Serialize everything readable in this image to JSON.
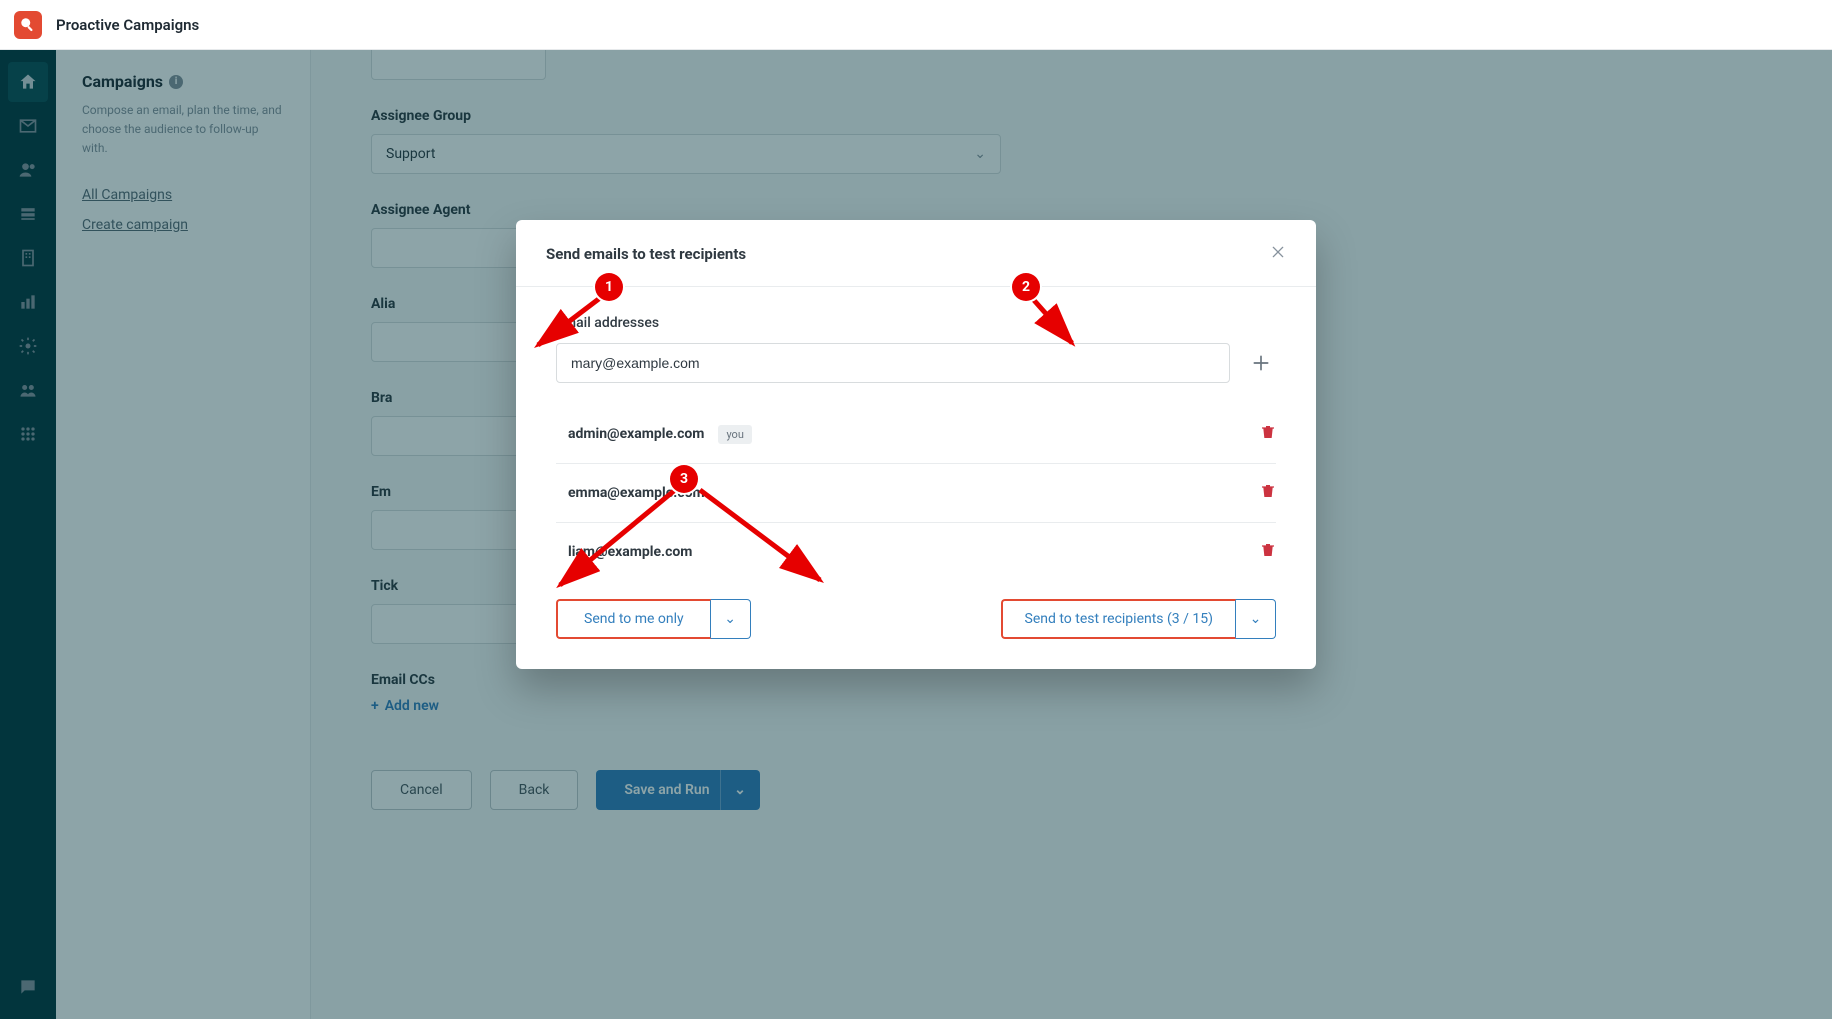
{
  "app": {
    "title": "Proactive Campaigns"
  },
  "sidebar": {
    "heading": "Campaigns",
    "description": "Compose an email, plan the time, and choose the audience to follow-up with.",
    "links": {
      "all": "All Campaigns",
      "create": "Create campaign"
    }
  },
  "form": {
    "assignee_group_label": "Assignee Group",
    "assignee_group_value": "Support",
    "assignee_agent_label": "Assignee Agent",
    "alias_label": "Alia",
    "brand_label": "Bra",
    "em_label": "Em",
    "tick_label": "Tick",
    "email_ccs_label": "Email CCs",
    "add_new": "Add new",
    "buttons": {
      "cancel": "Cancel",
      "back": "Back",
      "save_run": "Save and Run"
    }
  },
  "modal": {
    "title": "Send emails to test recipients",
    "field_label": "Email addresses",
    "input_value": "mary@example.com",
    "you_tag": "you",
    "recipients": [
      {
        "email": "admin@example.com",
        "is_you": true
      },
      {
        "email": "emma@example.com",
        "is_you": false
      },
      {
        "email": "liam@example.com",
        "is_you": false
      }
    ],
    "send_me": "Send to me only",
    "send_test": "Send to test recipients (3 / 15)"
  },
  "annotations": {
    "b1": "1",
    "b2": "2",
    "b3": "3"
  }
}
